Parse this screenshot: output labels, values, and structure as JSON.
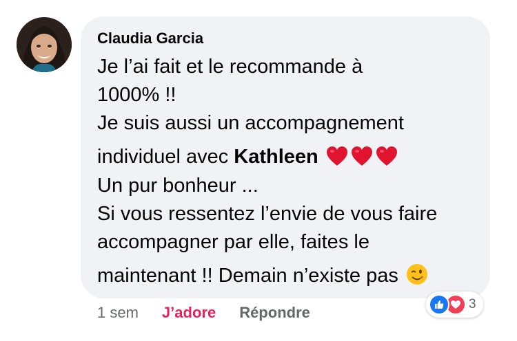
{
  "comment": {
    "author": "Claudia Garcia",
    "lines": {
      "l1": "Je l’ai fait et le recommande à",
      "l2": "1000% !!",
      "l3": "Je suis aussi un accompagnement",
      "l4_pre": "individuel avec ",
      "l4_mention": "Kathleen",
      "l5": "Un pur bonheur ...",
      "l6": "Si vous ressentez l’envie de vous faire",
      "l7": "accompagner par elle, faites le",
      "l8": "maintenant !! Demain n’existe pas"
    },
    "emojis": [
      "heart-icon",
      "heart-icon",
      "heart-icon",
      "winking-face-icon"
    ]
  },
  "actions": {
    "time": "1 sem",
    "like_label": "J’adore",
    "reply_label": "Répondre"
  },
  "reactions": {
    "types": [
      "like-icon",
      "love-icon"
    ],
    "count": "3"
  },
  "colors": {
    "bubble": "#f0f2f5",
    "love": "#e0245e",
    "like_blue": "#1877f2",
    "heart_red": "#e0142e"
  }
}
